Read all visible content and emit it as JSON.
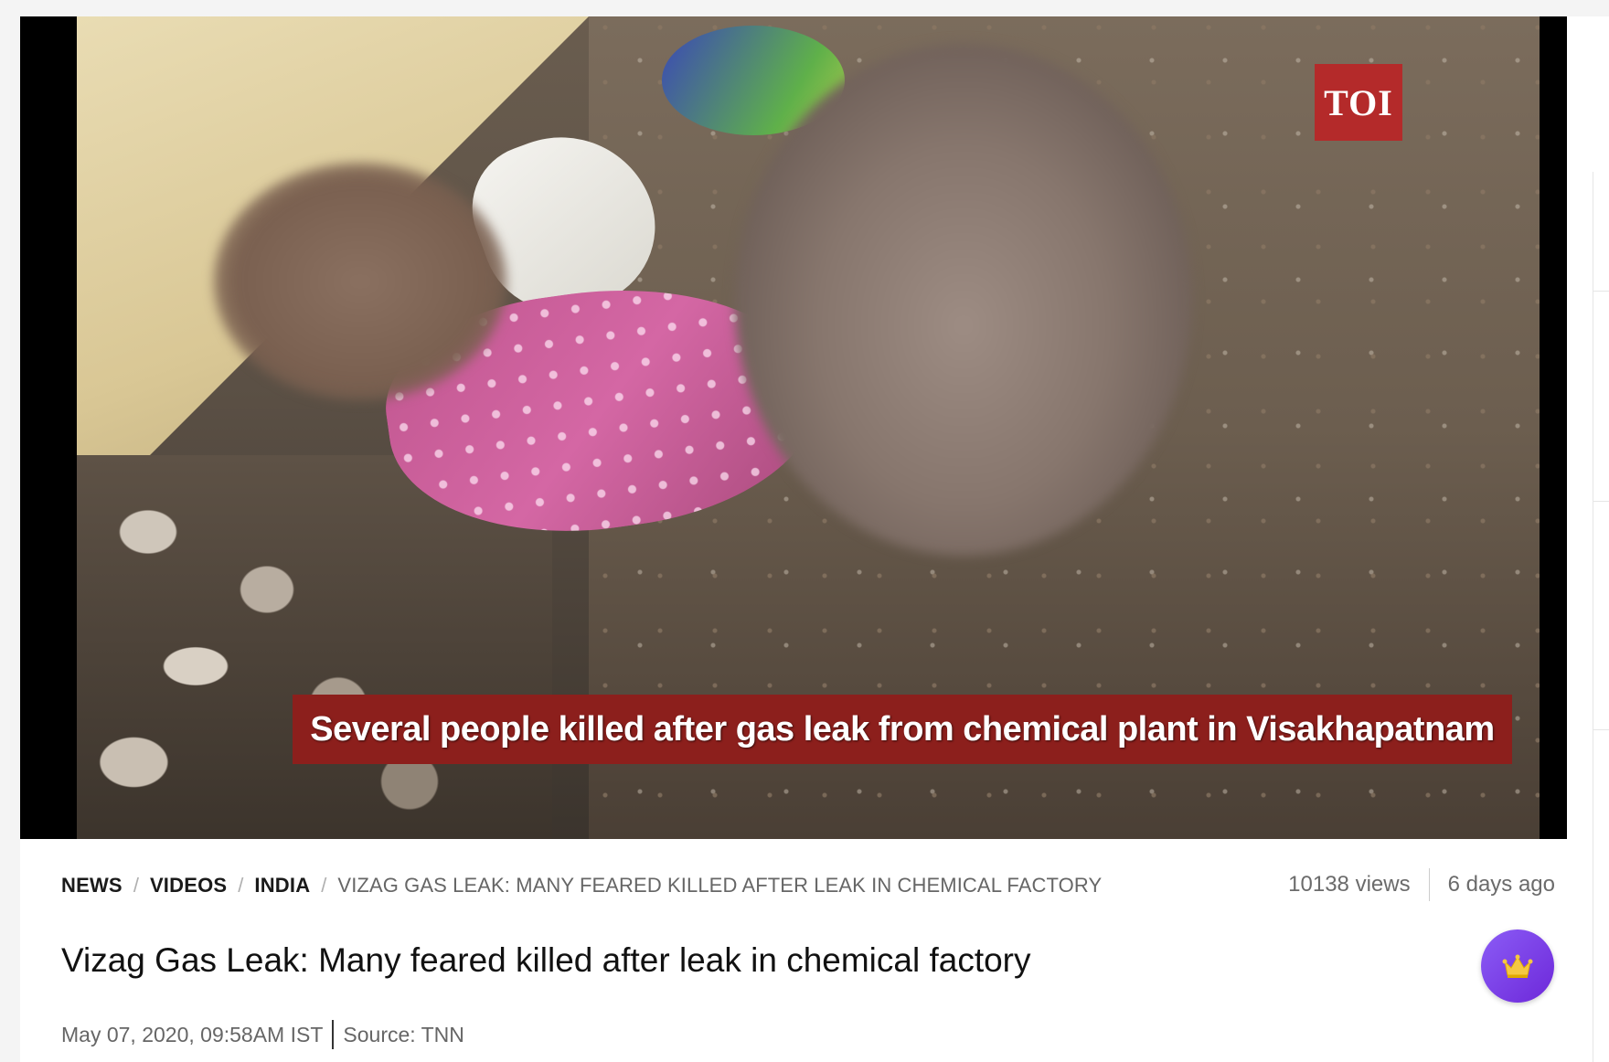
{
  "video": {
    "caption": "Several people killed after gas leak from chemical plant in Visakhapatnam",
    "logo_text": "TOI"
  },
  "breadcrumb": {
    "items": [
      "NEWS",
      "VIDEOS",
      "INDIA"
    ],
    "separator": "/",
    "current": "VIZAG GAS LEAK: MANY FEARED KILLED AFTER LEAK IN CHEMICAL FACTORY"
  },
  "stats": {
    "views": "10138 views",
    "age": "6 days ago"
  },
  "article": {
    "title": "Vizag Gas Leak: Many feared killed after leak in chemical factory",
    "date": "May 07, 2020, 09:58AM IST",
    "source": "Source: TNN"
  },
  "icons": {
    "crown": "crown-icon"
  },
  "colors": {
    "logo_bg": "#b42a2a",
    "caption_bg": "#8c1f1c",
    "crown_button": "#7c3aed"
  }
}
